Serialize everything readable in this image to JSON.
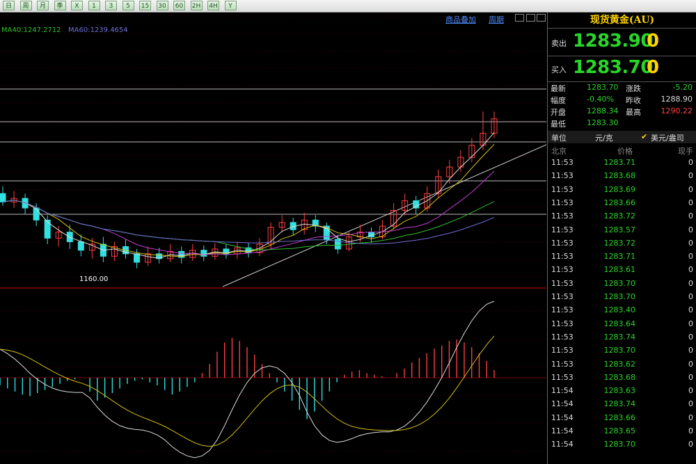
{
  "toolbar": {
    "buttons": [
      "日",
      "周",
      "月",
      "季",
      "X",
      "1",
      "3",
      "5",
      "15",
      "30",
      "60",
      "2H",
      "4H",
      "Y"
    ]
  },
  "chart_header": {
    "ma40": "MA40:1247.2712",
    "ma60": "MA60:1239.4654",
    "link_overlay": "商品叠加",
    "link_period": "周期"
  },
  "chart_data": {
    "type": "candlestick",
    "low_annotation": "1160.00",
    "price_candles": [
      {
        "o": 1222,
        "c": 1215,
        "h": 1228,
        "l": 1212
      },
      {
        "o": 1215,
        "c": 1218,
        "h": 1224,
        "l": 1210
      },
      {
        "o": 1218,
        "c": 1210,
        "h": 1222,
        "l": 1205
      },
      {
        "o": 1210,
        "c": 1200,
        "h": 1214,
        "l": 1195
      },
      {
        "o": 1200,
        "c": 1185,
        "h": 1204,
        "l": 1180
      },
      {
        "o": 1185,
        "c": 1190,
        "h": 1195,
        "l": 1178
      },
      {
        "o": 1190,
        "c": 1182,
        "h": 1196,
        "l": 1176
      },
      {
        "o": 1182,
        "c": 1175,
        "h": 1188,
        "l": 1170
      },
      {
        "o": 1175,
        "c": 1180,
        "h": 1185,
        "l": 1168
      },
      {
        "o": 1180,
        "c": 1170,
        "h": 1186,
        "l": 1165
      },
      {
        "o": 1170,
        "c": 1178,
        "h": 1182,
        "l": 1166
      },
      {
        "o": 1178,
        "c": 1172,
        "h": 1184,
        "l": 1168
      },
      {
        "o": 1172,
        "c": 1165,
        "h": 1176,
        "l": 1160
      },
      {
        "o": 1165,
        "c": 1172,
        "h": 1178,
        "l": 1162
      },
      {
        "o": 1172,
        "c": 1168,
        "h": 1177,
        "l": 1164
      },
      {
        "o": 1168,
        "c": 1174,
        "h": 1180,
        "l": 1165
      },
      {
        "o": 1174,
        "c": 1169,
        "h": 1178,
        "l": 1164
      },
      {
        "o": 1169,
        "c": 1175,
        "h": 1180,
        "l": 1166
      },
      {
        "o": 1175,
        "c": 1170,
        "h": 1179,
        "l": 1166
      },
      {
        "o": 1170,
        "c": 1176,
        "h": 1181,
        "l": 1167
      },
      {
        "o": 1176,
        "c": 1172,
        "h": 1180,
        "l": 1168
      },
      {
        "o": 1172,
        "c": 1177,
        "h": 1182,
        "l": 1168
      },
      {
        "o": 1177,
        "c": 1173,
        "h": 1181,
        "l": 1169
      },
      {
        "o": 1173,
        "c": 1180,
        "h": 1185,
        "l": 1170
      },
      {
        "o": 1180,
        "c": 1194,
        "h": 1198,
        "l": 1176
      },
      {
        "o": 1194,
        "c": 1198,
        "h": 1204,
        "l": 1190
      },
      {
        "o": 1198,
        "c": 1192,
        "h": 1202,
        "l": 1187
      },
      {
        "o": 1192,
        "c": 1200,
        "h": 1206,
        "l": 1188
      },
      {
        "o": 1200,
        "c": 1195,
        "h": 1204,
        "l": 1190
      },
      {
        "o": 1195,
        "c": 1184,
        "h": 1198,
        "l": 1180
      },
      {
        "o": 1184,
        "c": 1176,
        "h": 1188,
        "l": 1172
      },
      {
        "o": 1176,
        "c": 1186,
        "h": 1190,
        "l": 1174
      },
      {
        "o": 1186,
        "c": 1190,
        "h": 1196,
        "l": 1182
      },
      {
        "o": 1190,
        "c": 1186,
        "h": 1194,
        "l": 1181
      },
      {
        "o": 1186,
        "c": 1195,
        "h": 1200,
        "l": 1184
      },
      {
        "o": 1195,
        "c": 1208,
        "h": 1214,
        "l": 1192
      },
      {
        "o": 1208,
        "c": 1216,
        "h": 1222,
        "l": 1204
      },
      {
        "o": 1216,
        "c": 1210,
        "h": 1220,
        "l": 1205
      },
      {
        "o": 1210,
        "c": 1222,
        "h": 1228,
        "l": 1207
      },
      {
        "o": 1222,
        "c": 1236,
        "h": 1242,
        "l": 1218
      },
      {
        "o": 1236,
        "c": 1244,
        "h": 1250,
        "l": 1230
      },
      {
        "o": 1244,
        "c": 1252,
        "h": 1258,
        "l": 1240
      },
      {
        "o": 1252,
        "c": 1262,
        "h": 1268,
        "l": 1248
      },
      {
        "o": 1262,
        "c": 1272,
        "h": 1290,
        "l": 1258
      },
      {
        "o": 1272,
        "c": 1284,
        "h": 1290,
        "l": 1268
      }
    ],
    "macd_histogram": [
      -10,
      -14,
      -18,
      -22,
      -24,
      -20,
      -16,
      -12,
      -8,
      -4,
      -2,
      0,
      -18,
      -30,
      -26,
      -20,
      -14,
      -8,
      -4,
      -2,
      -6,
      -10,
      -16,
      -22,
      -18,
      -12,
      -6,
      6,
      18,
      34,
      46,
      52,
      48,
      40,
      30,
      18,
      6,
      -6,
      -18,
      -30,
      -42,
      -54,
      -44,
      -30,
      -18,
      -6,
      4,
      8,
      10,
      6,
      4,
      2,
      0,
      6,
      12,
      20,
      26,
      32,
      38,
      42,
      48,
      50,
      46,
      40,
      32,
      22,
      10
    ]
  },
  "panel": {
    "title": "现货黄金(AU)",
    "sell_label": "卖出",
    "sell_price": "1283.90",
    "sell_vol": "0",
    "buy_label": "买入",
    "buy_price": "1283.70",
    "buy_vol": "0",
    "stats": {
      "latest_label": "最新",
      "latest": "1283.70",
      "change_label": "涨跌",
      "change": "-5.20",
      "amp_label": "幅度",
      "amp": "-0.40%",
      "prev_label": "昨收",
      "prev": "1288.90",
      "open_label": "开盘",
      "open": "1288.34",
      "high_label": "最高",
      "high": "1290.22",
      "low_label": "最低",
      "low": "1283.30"
    },
    "unit_label": "单位",
    "unit_value": "元/克",
    "unit_alt": "美元/盎司",
    "head_city": "北京",
    "head_price": "价格",
    "head_vol": "现手",
    "ticks": [
      {
        "t": "11:53",
        "p": "1283.71",
        "v": "0"
      },
      {
        "t": "11:53",
        "p": "1283.68",
        "v": "0"
      },
      {
        "t": "11:53",
        "p": "1283.69",
        "v": "0"
      },
      {
        "t": "11:53",
        "p": "1283.66",
        "v": "0"
      },
      {
        "t": "11:53",
        "p": "1283.72",
        "v": "0"
      },
      {
        "t": "11:53",
        "p": "1283.57",
        "v": "0"
      },
      {
        "t": "11:53",
        "p": "1283.72",
        "v": "0"
      },
      {
        "t": "11:53",
        "p": "1283.71",
        "v": "0"
      },
      {
        "t": "11:53",
        "p": "1283.61",
        "v": "0"
      },
      {
        "t": "11:53",
        "p": "1283.70",
        "v": "0"
      },
      {
        "t": "11:53",
        "p": "1283.70",
        "v": "0"
      },
      {
        "t": "11:53",
        "p": "1283.40",
        "v": "0"
      },
      {
        "t": "11:53",
        "p": "1283.64",
        "v": "0"
      },
      {
        "t": "11:53",
        "p": "1283.74",
        "v": "0"
      },
      {
        "t": "11:53",
        "p": "1283.70",
        "v": "0"
      },
      {
        "t": "11:53",
        "p": "1283.62",
        "v": "0"
      },
      {
        "t": "11:53",
        "p": "1283.68",
        "v": "0"
      },
      {
        "t": "11:54",
        "p": "1283.63",
        "v": "0"
      },
      {
        "t": "11:54",
        "p": "1283.74",
        "v": "0"
      },
      {
        "t": "11:54",
        "p": "1283.66",
        "v": "0"
      },
      {
        "t": "11:54",
        "p": "1283.65",
        "v": "0"
      },
      {
        "t": "11:54",
        "p": "1283.70",
        "v": "0"
      }
    ]
  },
  "colors": {
    "up": "#ff4040",
    "down": "#33e0e0",
    "ma_white": "#dddddd",
    "ma_yellow": "#d6c21a",
    "ma_green": "#2fc02f",
    "ma_purple": "#c23fd2",
    "ma_blue": "#6f6fd6",
    "grid_red": "#7a0000"
  }
}
